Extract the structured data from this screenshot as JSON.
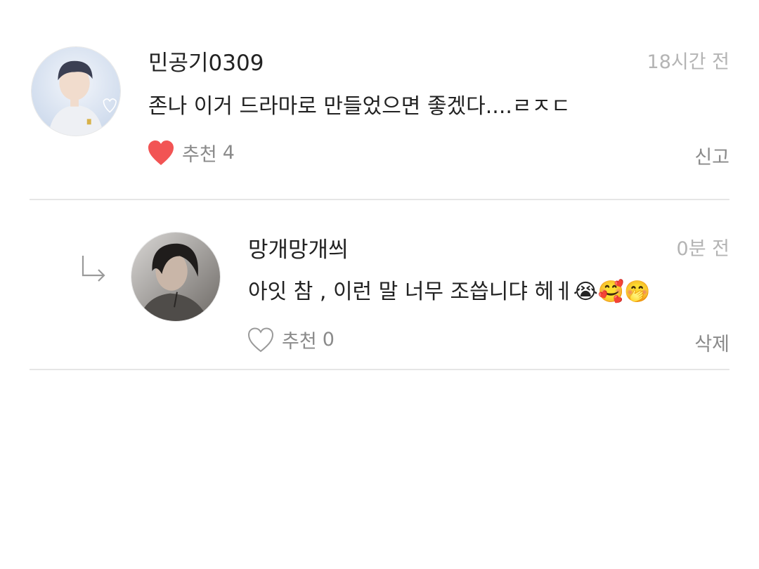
{
  "comments": [
    {
      "username": "민공기0309",
      "time": "18시간 전",
      "text": "존나 이거 드라마로 만들었으면 좋겠다....ㄹㅈㄷ",
      "like_label": "추천",
      "like_count": "4",
      "liked": true,
      "action": "신고"
    },
    {
      "username": "망개망개씌",
      "time": "0분 전",
      "text": "아잇 참 , 이런 말 너무 조씁니댜 헤ㅔ😭🥰🤭",
      "like_label": "추천",
      "like_count": "0",
      "liked": false,
      "action": "삭제",
      "is_reply": true
    }
  ],
  "colors": {
    "heart_filled": "#f25454",
    "muted_text": "#8a8a8a",
    "time_text": "#b4b4b4",
    "divider": "#e6e6e6"
  },
  "icons": {
    "reply": "reply-arrow-icon",
    "like_filled": "heart-filled-icon",
    "like_outline": "heart-outline-icon"
  }
}
